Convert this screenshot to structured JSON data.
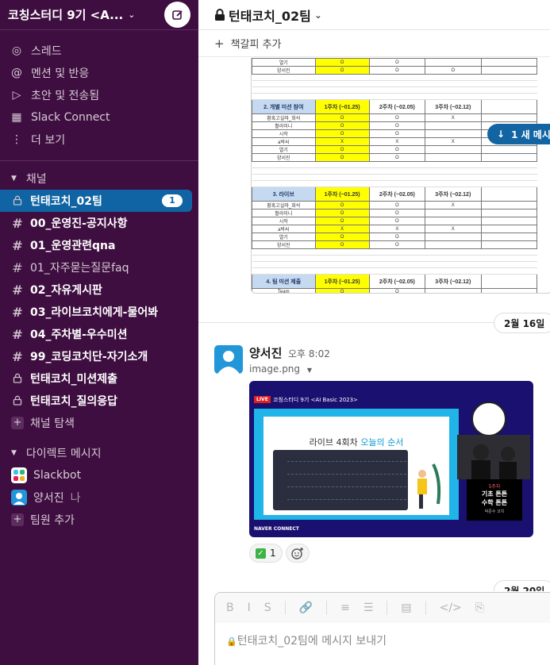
{
  "workspace": {
    "name": "코칭스터디 9기 <A..."
  },
  "nav": [
    {
      "label": "스레드",
      "icon": "threads-icon",
      "glyph": "◎"
    },
    {
      "label": "멘션 및 반응",
      "icon": "at-icon",
      "glyph": "@"
    },
    {
      "label": "초안 및 전송됨",
      "icon": "send-icon",
      "glyph": "▷"
    },
    {
      "label": "Slack Connect",
      "icon": "building-icon",
      "glyph": "▦"
    },
    {
      "label": "더 보기",
      "icon": "more-icon",
      "glyph": "⋮"
    }
  ],
  "channels_section": "채널",
  "channels": [
    {
      "name": "턴태코치_02팀",
      "icon": "lock",
      "state": "active",
      "badge": "1"
    },
    {
      "name": "00_운영진-공지사항",
      "icon": "hash",
      "state": "bold"
    },
    {
      "name": "01_운영관련qna",
      "icon": "hash",
      "state": "bold"
    },
    {
      "name": "01_자주묻는질문faq",
      "icon": "hash",
      "state": "normal"
    },
    {
      "name": "02_자유게시판",
      "icon": "hash",
      "state": "bold"
    },
    {
      "name": "03_라이브코치에게-물어봐",
      "icon": "hash",
      "state": "bold"
    },
    {
      "name": "04_주차별-우수미션",
      "icon": "hash",
      "state": "bold"
    },
    {
      "name": "99_코딩코치단-자기소개",
      "icon": "hash",
      "state": "bold"
    },
    {
      "name": "턴태코치_미션제출",
      "icon": "lock",
      "state": "bold"
    },
    {
      "name": "턴태코치_질의응답",
      "icon": "lock",
      "state": "bold"
    }
  ],
  "browse_channels": "채널 탐색",
  "dm_section": "다이렉트 메시지",
  "dms": [
    {
      "name": "Slackbot",
      "suffix": ""
    },
    {
      "name": "양서진",
      "suffix": "나"
    }
  ],
  "add_member": "팀원 추가",
  "channel_header": {
    "title": "턴태코치_02팀"
  },
  "bookmark": {
    "label": "책갈피 추가"
  },
  "new_messages": {
    "label": "1 새 메시"
  },
  "sheet": {
    "top_rows": [
      [
        "열기",
        "O",
        "O",
        ""
      ],
      [
        "양서진",
        "O",
        "O",
        "O"
      ]
    ],
    "sections": [
      {
        "title": "2. 개별 미션 참여",
        "weeks": [
          "1주차 (~01.25)",
          "2주차 (~02.05)",
          "3주차 (~02.12)"
        ],
        "rows": [
          [
            "황혹고실마_화석",
            "O",
            "O",
            "X"
          ],
          [
            "활라미니",
            "O",
            "O",
            ""
          ],
          [
            "시작",
            "O",
            "O",
            ""
          ],
          [
            "a박씨",
            "X",
            "X",
            "X"
          ],
          [
            "열기",
            "O",
            "O",
            ""
          ],
          [
            "양서진",
            "O",
            "O",
            ""
          ]
        ]
      },
      {
        "title": "3. 라이브",
        "weeks": [
          "1주차 (~01.25)",
          "2주차 (~02.05)",
          "3주차 (~02.12)"
        ],
        "rows": [
          [
            "황혹고실마_화석",
            "O",
            "O",
            "X"
          ],
          [
            "활라미니",
            "O",
            "O",
            ""
          ],
          [
            "시작",
            "O",
            "O",
            ""
          ],
          [
            "a박씨",
            "X",
            "X",
            "X"
          ],
          [
            "열기",
            "O",
            "O",
            ""
          ],
          [
            "양서진",
            "O",
            "O",
            ""
          ]
        ]
      },
      {
        "title": "4. 팀 미션 제출",
        "weeks": [
          "1주차 (~01.25)",
          "2주차 (~02.05)",
          "3주차 (~02.12)"
        ],
        "rows": [
          [
            "Team",
            "O",
            "O",
            ""
          ]
        ]
      }
    ]
  },
  "date_divider": "2월 16일",
  "date_divider2": "2월 20일",
  "message": {
    "author": "양서진",
    "time": "오후 8:02",
    "file": "image.png",
    "image": {
      "live_tag": "LIVE",
      "top_title": "코칭스터디 9기 <AI Basic 2023>",
      "slide_title_a": "라이브 4회차",
      "slide_title_b": "오늘의 순서",
      "plate_week": "5주차",
      "plate_line1": "기초 튼튼",
      "plate_line2": "수학 튼튼",
      "plate_coach": "박준수 코치",
      "footer": "NAVER CONNECT"
    },
    "reaction": {
      "emoji": "✓",
      "count": "1"
    }
  },
  "composer": {
    "placeholder": "턴태코치_02팀에 메시지 보내기",
    "tools": [
      "B",
      "I",
      "S",
      "🔗",
      "≡",
      "☰",
      "▤",
      "</>",
      "⎘"
    ]
  },
  "colors": {
    "sidebar": "#3f0e40",
    "active": "#1164a3",
    "highlight": "#ffff00"
  }
}
